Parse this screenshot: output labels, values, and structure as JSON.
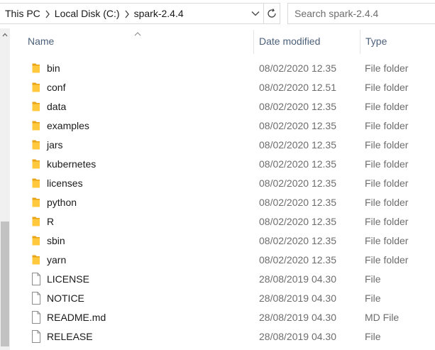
{
  "address": {
    "crumbs": [
      "This PC",
      "Local Disk (C:)",
      "spark-2.4.4"
    ]
  },
  "search": {
    "placeholder": "Search spark-2.4.4"
  },
  "columns": {
    "name": "Name",
    "date": "Date modified",
    "type": "Type"
  },
  "files": [
    {
      "name": "bin",
      "date": "08/02/2020 12.35",
      "type": "File folder",
      "icon": "folder-icon"
    },
    {
      "name": "conf",
      "date": "08/02/2020 12.51",
      "type": "File folder",
      "icon": "folder-icon"
    },
    {
      "name": "data",
      "date": "08/02/2020 12.35",
      "type": "File folder",
      "icon": "folder-icon"
    },
    {
      "name": "examples",
      "date": "08/02/2020 12.35",
      "type": "File folder",
      "icon": "folder-icon"
    },
    {
      "name": "jars",
      "date": "08/02/2020 12.35",
      "type": "File folder",
      "icon": "folder-icon"
    },
    {
      "name": "kubernetes",
      "date": "08/02/2020 12.35",
      "type": "File folder",
      "icon": "folder-icon"
    },
    {
      "name": "licenses",
      "date": "08/02/2020 12.35",
      "type": "File folder",
      "icon": "folder-icon"
    },
    {
      "name": "python",
      "date": "08/02/2020 12.35",
      "type": "File folder",
      "icon": "folder-icon"
    },
    {
      "name": "R",
      "date": "08/02/2020 12.35",
      "type": "File folder",
      "icon": "folder-icon"
    },
    {
      "name": "sbin",
      "date": "08/02/2020 12.35",
      "type": "File folder",
      "icon": "folder-icon"
    },
    {
      "name": "yarn",
      "date": "08/02/2020 12.35",
      "type": "File folder",
      "icon": "folder-icon"
    },
    {
      "name": "LICENSE",
      "date": "28/08/2019 04.30",
      "type": "File",
      "icon": "file-icon"
    },
    {
      "name": "NOTICE",
      "date": "28/08/2019 04.30",
      "type": "File",
      "icon": "file-icon"
    },
    {
      "name": "README.md",
      "date": "28/08/2019 04.30",
      "type": "MD File",
      "icon": "file-icon"
    },
    {
      "name": "RELEASE",
      "date": "28/08/2019 04.30",
      "type": "File",
      "icon": "file-icon"
    }
  ],
  "colors": {
    "folder": "#ffc83d",
    "header_text": "#4c607a",
    "meta_text": "#6d6d6d"
  }
}
